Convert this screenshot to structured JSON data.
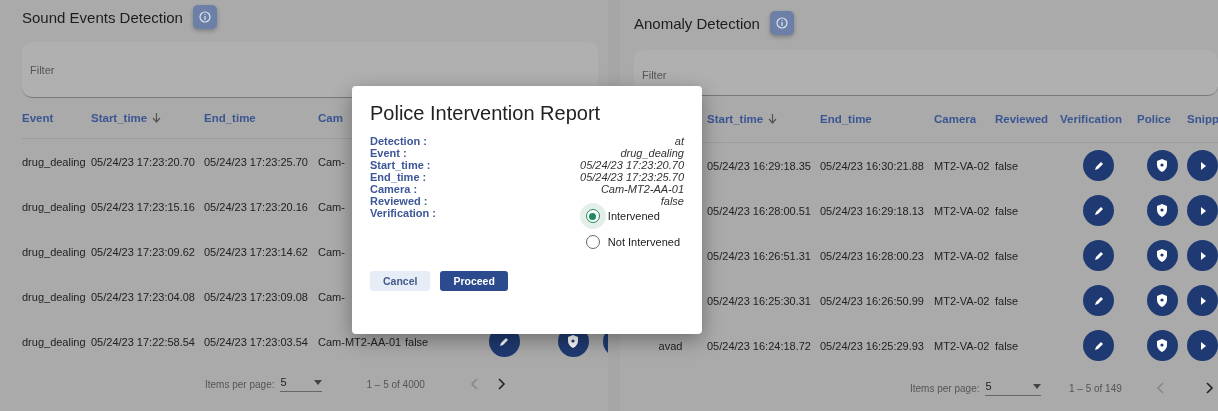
{
  "panels": [
    {
      "title": "Sound Events Detection",
      "filter": {
        "placeholder": "Filter"
      },
      "columns": [
        {
          "label": "Event"
        },
        {
          "label": "Start_time",
          "sorted": true
        },
        {
          "label": "End_time"
        },
        {
          "label": "Cam"
        }
      ],
      "rows": [
        {
          "kind": "partial",
          "event": "drug_dealing",
          "start_time": "05/24/23 17:23:20.70",
          "end_time": "05/24/23 17:23:25.70",
          "camera": "Cam-"
        },
        {
          "kind": "partial",
          "event": "drug_dealing",
          "start_time": "05/24/23 17:23:15.16",
          "end_time": "05/24/23 17:23:20.16",
          "camera": "Cam-"
        },
        {
          "kind": "partial",
          "event": "drug_dealing",
          "start_time": "05/24/23 17:23:09.62",
          "end_time": "05/24/23 17:23:14.62",
          "camera": "Cam-"
        },
        {
          "kind": "partial",
          "event": "drug_dealing",
          "start_time": "05/24/23 17:23:04.08",
          "end_time": "05/24/23 17:23:09.08",
          "camera": "Cam-"
        },
        {
          "kind": "full",
          "event": "drug_dealing",
          "start_time": "05/24/23 17:22:58.54",
          "end_time": "05/24/23 17:23:03.54",
          "camera": "Cam-MT2-AA-01",
          "reviewed": "false"
        }
      ],
      "pagination": {
        "label": "Items per page:",
        "page_size": "5",
        "range": "1 – 5 of 4000",
        "prev_disabled": true,
        "next_disabled": false
      }
    },
    {
      "title": "Anomaly Detection",
      "filter": {
        "placeholder": "Filter"
      },
      "columns": [
        {
          "label": "Start_time",
          "sorted": true
        },
        {
          "label": "End_time"
        },
        {
          "label": "Camera"
        },
        {
          "label": "Reviewed"
        },
        {
          "label": "Verification"
        },
        {
          "label": "Police"
        },
        {
          "label": "Snipp"
        }
      ],
      "rows": [
        {
          "kind": "full",
          "start_time": "05/24/23 16:29:18.35",
          "end_time": "05/24/23 16:30:21.88",
          "camera": "MT2-VA-02",
          "reviewed": "false"
        },
        {
          "kind": "full",
          "start_time": "05/24/23 16:28:00.51",
          "end_time": "05/24/23 16:29:18.13",
          "camera": "MT2-VA-02",
          "reviewed": "false"
        },
        {
          "kind": "full",
          "start_time": "05/24/23 16:26:51.31",
          "end_time": "05/24/23 16:28:00.23",
          "camera": "MT2-VA-02",
          "reviewed": "false"
        },
        {
          "kind": "full",
          "start_time": "05/24/23 16:25:30.31",
          "end_time": "05/24/23 16:26:50.99",
          "camera": "MT2-VA-02",
          "reviewed": "false"
        },
        {
          "kind": "full",
          "event": "avad",
          "start_time": "05/24/23 16:24:18.72",
          "end_time": "05/24/23 16:25:29.93",
          "camera": "MT2-VA-02",
          "reviewed": "false"
        }
      ],
      "pagination": {
        "label": "Items per page:",
        "page_size": "5",
        "range": "1 – 5 of 149",
        "prev_disabled": true,
        "next_disabled": false
      }
    }
  ],
  "dialog": {
    "title": "Police Intervention Report",
    "fields": [
      {
        "label": "Detection :",
        "value": "at"
      },
      {
        "label": "Event :",
        "value": "drug_dealing"
      },
      {
        "label": "Start_time :",
        "value": "05/24/23 17:23:20.70"
      },
      {
        "label": "End_time :",
        "value": "05/24/23 17:23:25.70"
      },
      {
        "label": "Camera :",
        "value": "Cam-MT2-AA-01"
      },
      {
        "label": "Reviewed :",
        "value": "false"
      }
    ],
    "verification": {
      "label": "Verification :",
      "options": [
        {
          "label": "Intervened",
          "selected": true
        },
        {
          "label": "Not Intervened",
          "selected": false
        }
      ]
    },
    "buttons": [
      {
        "label": "Cancel",
        "kind": "secondary"
      },
      {
        "label": "Proceed",
        "kind": "primary"
      }
    ]
  }
}
